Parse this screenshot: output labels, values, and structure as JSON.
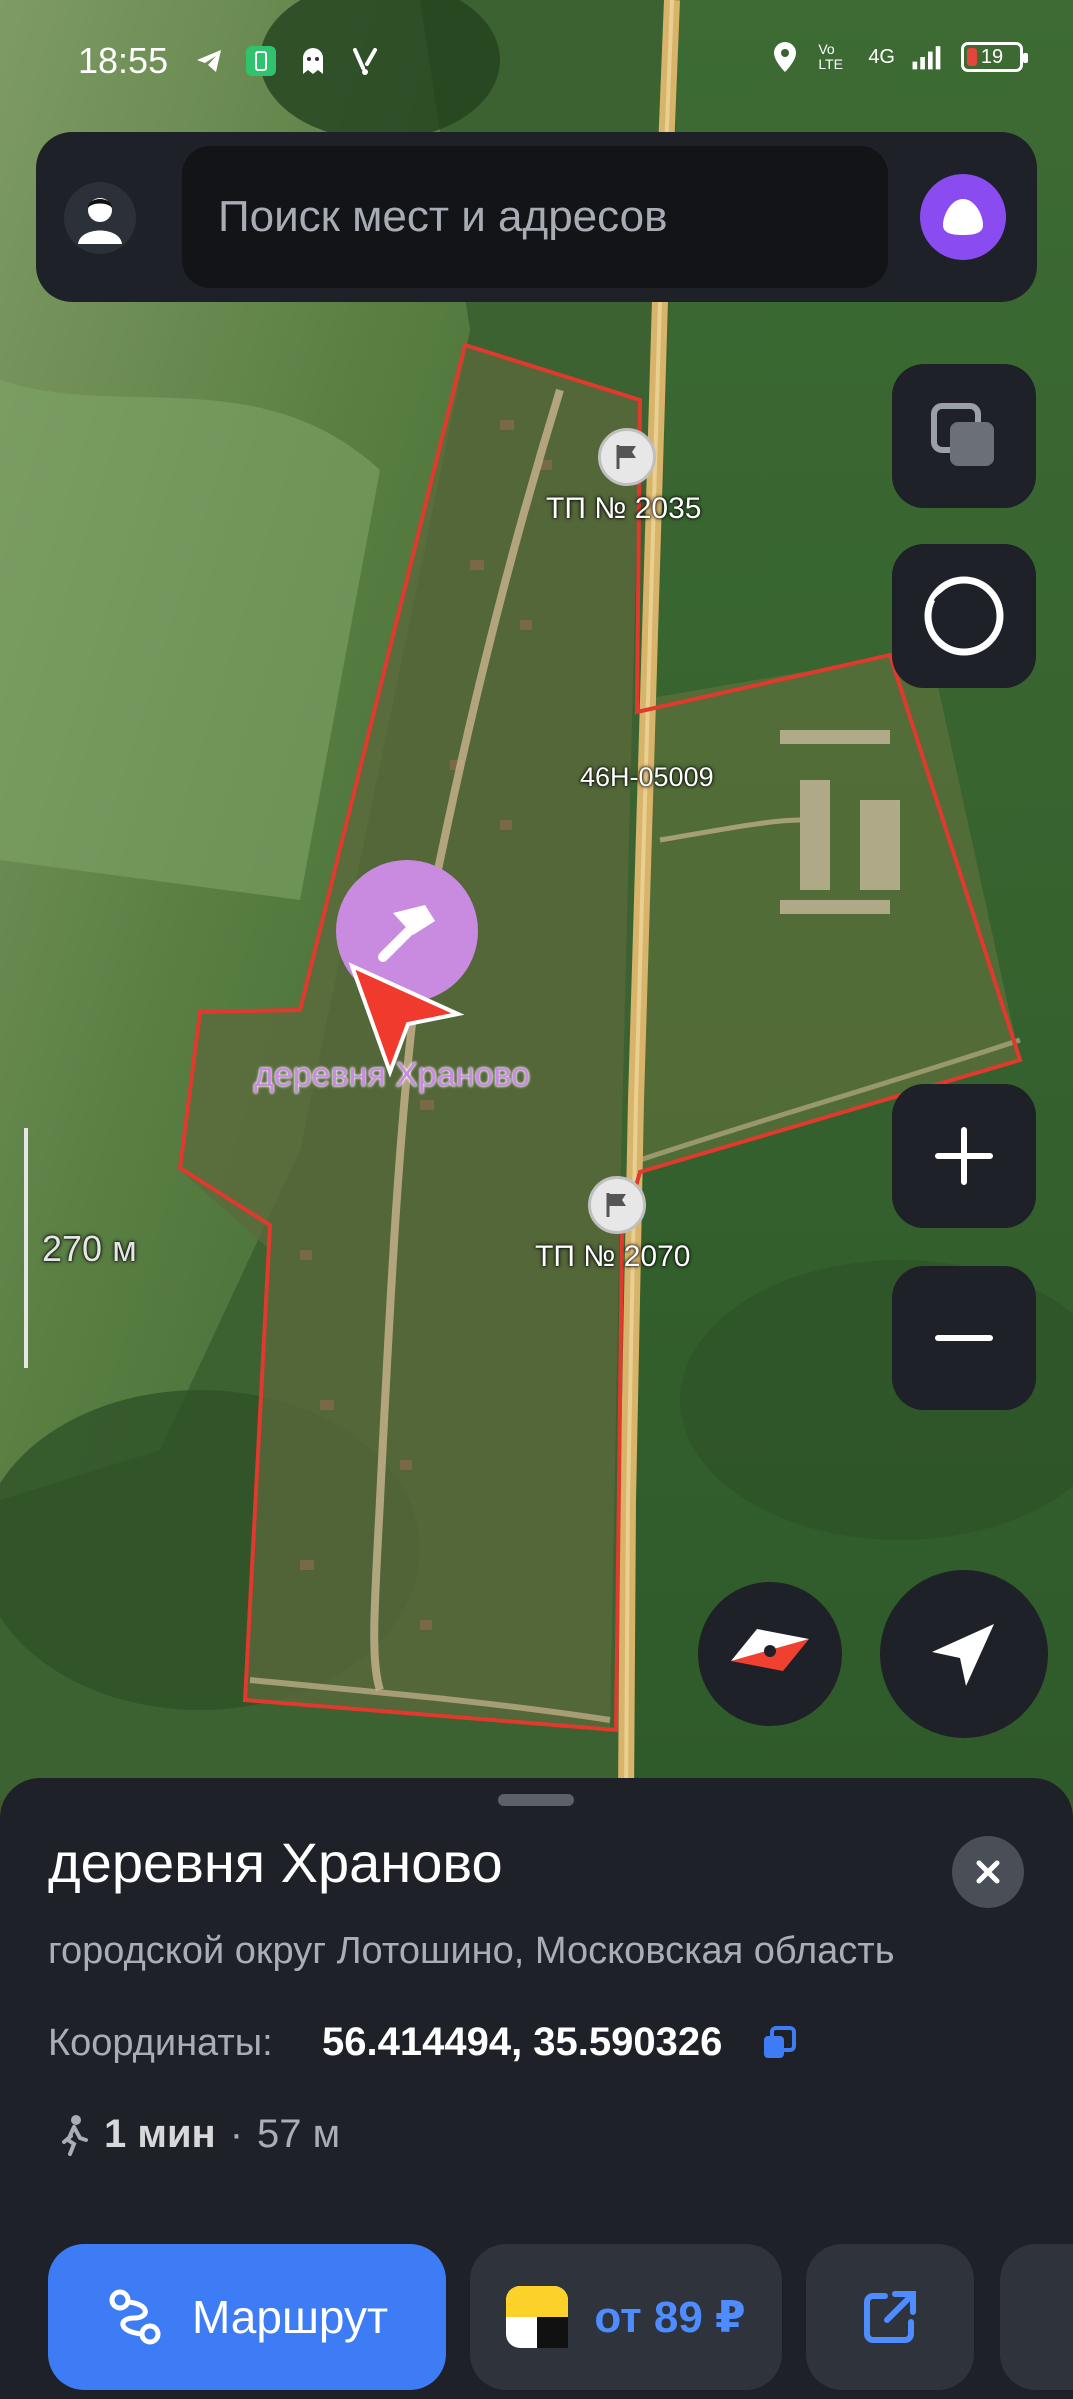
{
  "status_bar": {
    "time": "18:55",
    "network": "4G",
    "volte": "Vo LTE",
    "battery": "19"
  },
  "search": {
    "placeholder": "Поиск мест и адресов"
  },
  "map": {
    "labels": {
      "tp_2035": "ТП № 2035",
      "road": "46Н-05009",
      "tp_2070": "ТП № 2070",
      "place": "деревня Храново"
    },
    "scale": "270 м",
    "colors": {
      "boundary": "#e0392d",
      "road": "#d6b06a",
      "marker": "#c98be0",
      "arrow": "#f03a2e"
    }
  },
  "sheet": {
    "title": "деревня Храново",
    "subtitle": "городской округ Лотошино, Московская область",
    "coords_label": "Координаты:",
    "coords_value": "56.414494, 35.590326",
    "walk_time": "1 мин",
    "walk_sep": "·",
    "walk_dist": "57 м",
    "route_label": "Маршрут",
    "taxi_price": "от 89 ₽"
  },
  "icons": {
    "avatar": "user-avatar-icon",
    "alice": "alice-icon",
    "layers": "layers-icon",
    "alice_round": "circle-icon",
    "zoom_in": "plus-icon",
    "zoom_out": "minus-icon",
    "compass": "compass-icon",
    "locate": "location-arrow-icon",
    "close": "close-icon",
    "copy": "copy-icon",
    "walk": "walk-icon",
    "route": "route-icon",
    "taxi": "taxi-icon",
    "share": "share-icon"
  }
}
